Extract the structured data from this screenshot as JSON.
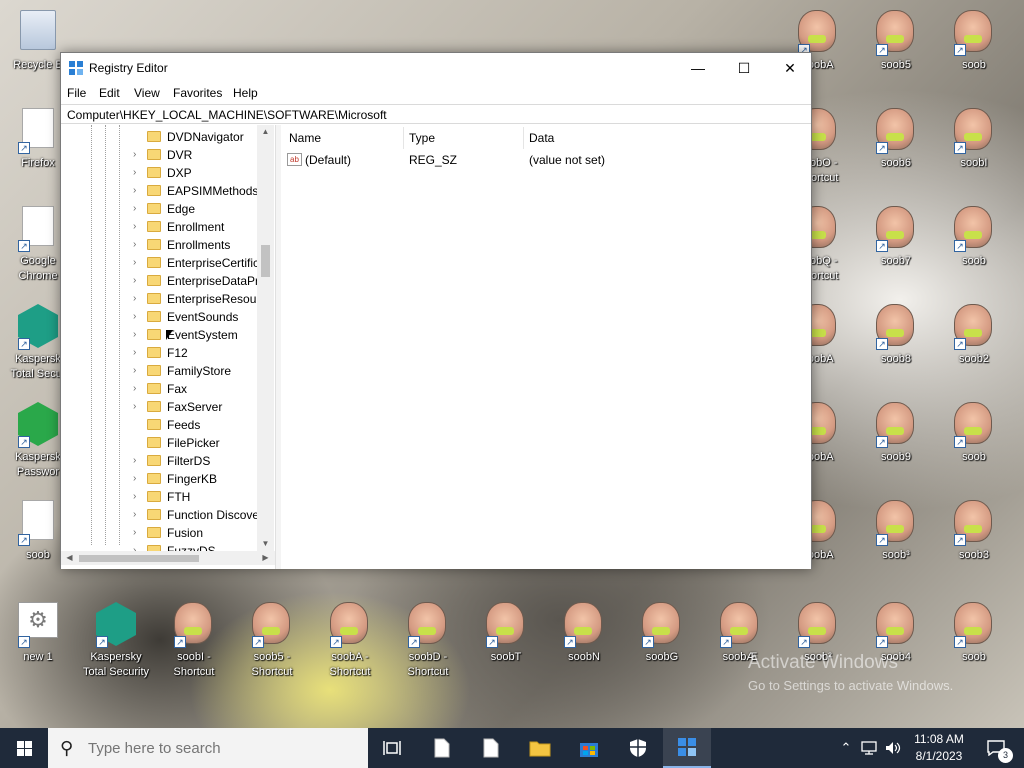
{
  "desktop": {
    "icons": [
      {
        "label": "Recycle B",
        "kind": "recycle"
      },
      {
        "label": "Firefox",
        "kind": "page"
      },
      {
        "label": "Google\nChrome",
        "kind": "page"
      },
      {
        "label": "Kaspersk\nTotal Secur",
        "kind": "kasp"
      },
      {
        "label": "Kaspersk\nPasswor",
        "kind": "kasp2"
      },
      {
        "label": "soob",
        "kind": "page"
      },
      {
        "label": "new 1",
        "kind": "gear"
      },
      {
        "label": "Kaspersky\nTotal Security",
        "kind": "kasp"
      },
      {
        "label": "soobI -\nShortcut",
        "kind": "face"
      },
      {
        "label": "soob5 -\nShortcut",
        "kind": "face"
      },
      {
        "label": "soobA -\nShortcut",
        "kind": "face"
      },
      {
        "label": "soobD -\nShortcut",
        "kind": "face"
      },
      {
        "label": "soobT",
        "kind": "face"
      },
      {
        "label": "soobN",
        "kind": "face"
      },
      {
        "label": "soobG",
        "kind": "face"
      },
      {
        "label": "soobÆ",
        "kind": "face"
      },
      {
        "label": "soob²",
        "kind": "face"
      },
      {
        "label": "soob4",
        "kind": "face"
      },
      {
        "label": "soob",
        "kind": "face"
      },
      {
        "label": "soobA",
        "kind": "face"
      },
      {
        "label": "soob5",
        "kind": "face"
      },
      {
        "label": "soob",
        "kind": "face"
      },
      {
        "label": "soob6",
        "kind": "face"
      },
      {
        "label": "soobI",
        "kind": "face"
      },
      {
        "label": "soobO -\nShortcut",
        "kind": "face"
      },
      {
        "label": "soobQ -\nShortcut",
        "kind": "face"
      },
      {
        "label": "soob7",
        "kind": "face"
      },
      {
        "label": "soob",
        "kind": "face"
      },
      {
        "label": "soobA",
        "kind": "face"
      },
      {
        "label": "soob8",
        "kind": "face"
      },
      {
        "label": "soob2",
        "kind": "face"
      },
      {
        "label": "soobA",
        "kind": "face"
      },
      {
        "label": "soob9",
        "kind": "face"
      },
      {
        "label": "soob",
        "kind": "face"
      },
      {
        "label": "soobA",
        "kind": "face"
      },
      {
        "label": "soob³",
        "kind": "face"
      },
      {
        "label": "soob3",
        "kind": "face"
      },
      {
        "label": "Passwor...",
        "kind": "none"
      },
      {
        "label": "Shortcut",
        "kind": "none"
      },
      {
        "label": "Shortcut",
        "kind": "none"
      },
      {
        "label": "Shortcut",
        "kind": "none"
      }
    ]
  },
  "window": {
    "title": "Registry Editor",
    "minimize_glyph": "—",
    "maximize_glyph": "☐",
    "close_glyph": "✕"
  },
  "menu": {
    "file": "File",
    "edit": "Edit",
    "view": "View",
    "favorites": "Favorites",
    "help": "Help"
  },
  "address": "Computer\\HKEY_LOCAL_MACHINE\\SOFTWARE\\Microsoft",
  "tree": {
    "items": [
      {
        "label": "DVDNavigator",
        "expandable": false
      },
      {
        "label": "DVR",
        "expandable": true
      },
      {
        "label": "DXP",
        "expandable": true
      },
      {
        "label": "EAPSIMMethods",
        "expandable": true
      },
      {
        "label": "Edge",
        "expandable": true
      },
      {
        "label": "Enrollment",
        "expandable": true
      },
      {
        "label": "Enrollments",
        "expandable": true
      },
      {
        "label": "EnterpriseCertific",
        "expandable": true
      },
      {
        "label": "EnterpriseDataPro",
        "expandable": true
      },
      {
        "label": "EnterpriseResour",
        "expandable": true
      },
      {
        "label": "EventSounds",
        "expandable": true
      },
      {
        "label": "EventSystem",
        "expandable": true
      },
      {
        "label": "F12",
        "expandable": true
      },
      {
        "label": "FamilyStore",
        "expandable": true
      },
      {
        "label": "Fax",
        "expandable": true
      },
      {
        "label": "FaxServer",
        "expandable": true
      },
      {
        "label": "Feeds",
        "expandable": false
      },
      {
        "label": "FilePicker",
        "expandable": false
      },
      {
        "label": "FilterDS",
        "expandable": true
      },
      {
        "label": "FingerKB",
        "expandable": true
      },
      {
        "label": "FTH",
        "expandable": true
      },
      {
        "label": "Function Discove",
        "expandable": true
      },
      {
        "label": "Fusion",
        "expandable": true
      },
      {
        "label": "FuzzyDS",
        "expandable": true
      }
    ]
  },
  "list": {
    "columns": {
      "name": "Name",
      "type": "Type",
      "data": "Data"
    },
    "rows": [
      {
        "name": "(Default)",
        "type": "REG_SZ",
        "data": "(value not set)"
      }
    ],
    "value_icon_text": "ab"
  },
  "watermark": {
    "title": "Activate Windows",
    "subtitle": "Go to Settings to activate Windows."
  },
  "taskbar": {
    "search_placeholder": "Type here to search",
    "time": "11:08 AM",
    "date": "8/1/2023",
    "notification_count": "3"
  }
}
